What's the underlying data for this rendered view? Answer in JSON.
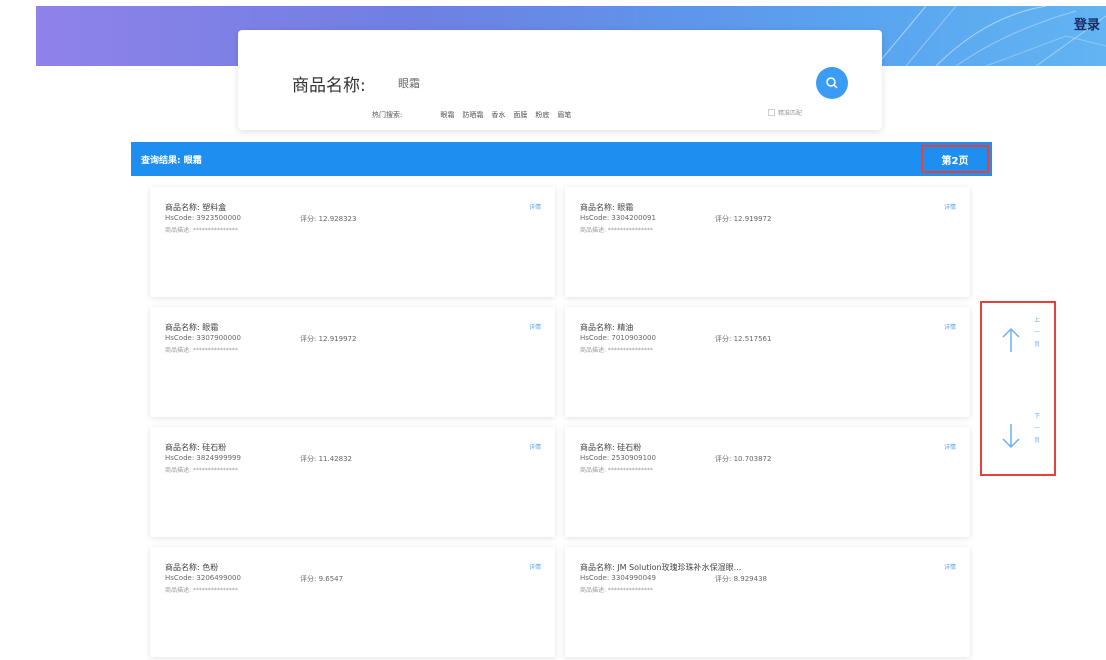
{
  "header": {
    "login": "登录"
  },
  "search": {
    "label": "商品名称:",
    "value": "眼霜",
    "hot_title": "热门搜索:",
    "hot_items": [
      "眼霜",
      "防晒霜",
      "香水",
      "面膜",
      "粉底",
      "眉笔"
    ],
    "exact_match": "精准匹配"
  },
  "result": {
    "label": "查询结果: 眼霜",
    "page": "第2页"
  },
  "cards": [
    {
      "name": "商品名称: 塑料盒",
      "hscode": "HsCode: 3923500000",
      "score": "评分: 12.928323",
      "desc": "商品描述: ***************",
      "link": "详情"
    },
    {
      "name": "商品名称: 眼霜",
      "hscode": "HsCode: 3304200091",
      "score": "评分: 12.919972",
      "desc": "商品描述: ***************",
      "link": "详情"
    },
    {
      "name": "商品名称: 眼霜",
      "hscode": "HsCode: 3307900000",
      "score": "评分: 12.919972",
      "desc": "商品描述: ***************",
      "link": "详情"
    },
    {
      "name": "商品名称: 精油",
      "hscode": "HsCode: 7010903000",
      "score": "评分: 12.517561",
      "desc": "商品描述: ***************",
      "link": "详情"
    },
    {
      "name": "商品名称: 硅石粉",
      "hscode": "HsCode: 3824999999",
      "score": "评分: 11.42832",
      "desc": "商品描述: ***************",
      "link": "详情"
    },
    {
      "name": "商品名称: 硅石粉",
      "hscode": "HsCode: 2530909100",
      "score": "评分: 10.703872",
      "desc": "商品描述: ***************",
      "link": "详情"
    },
    {
      "name": "商品名称: 色粉",
      "hscode": "HsCode: 3206499000",
      "score": "评分: 9.6547",
      "desc": "商品描述: ***************",
      "link": "详情"
    },
    {
      "name": "商品名称: JM Solution玫瑰珍珠补水保湿眼...",
      "hscode": "HsCode: 3304990049",
      "score": "评分: 8.929438",
      "desc": "商品描述: ***************",
      "link": "详情"
    }
  ],
  "nav": {
    "prev": "上一页",
    "next": "下一页"
  }
}
